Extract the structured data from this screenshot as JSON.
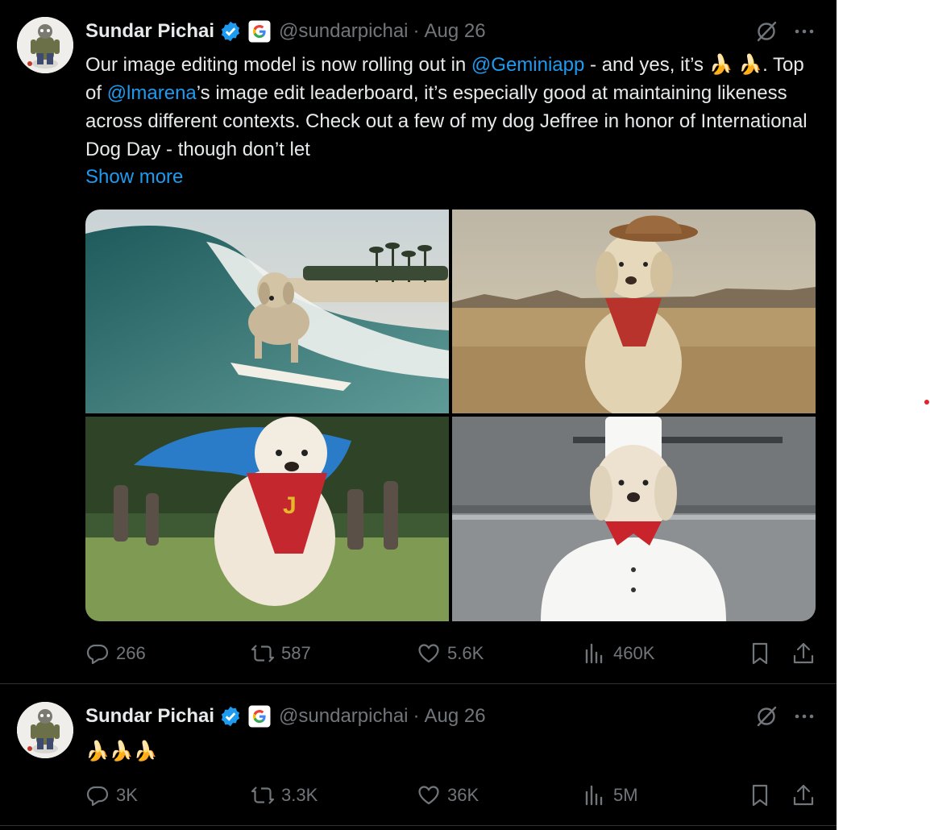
{
  "tweets": [
    {
      "author": "Sundar Pichai",
      "handle": "@sundarpichai",
      "sep": "·",
      "date": "Aug 26",
      "text": {
        "p1": "Our image editing model is now rolling out in ",
        "m1": "@Geminiapp",
        "p2": " - and yes, it’s 🍌 🍌. Top of ",
        "m2": "@lmarena",
        "p3": "’s image edit leaderboard, it’s especially good at maintaining likeness across different contexts. Check out a few of my dog Jeffree in honor of International Dog Day - though don’t let"
      },
      "show_more": "Show more",
      "media": [
        "dog surfing a wave",
        "dog in cowboy hat in desert",
        "dog in superhero cape",
        "dog dressed as chef"
      ],
      "metrics": {
        "replies": "266",
        "reposts": "587",
        "likes": "5.6K",
        "views": "460K"
      }
    },
    {
      "author": "Sundar Pichai",
      "handle": "@sundarpichai",
      "sep": "·",
      "date": "Aug 26",
      "text": "🍌🍌🍌",
      "metrics": {
        "replies": "3K",
        "reposts": "3.3K",
        "likes": "36K",
        "views": "5M"
      }
    }
  ],
  "icons": [
    "verified-badge-icon",
    "google-g-icon",
    "grok-icon",
    "more-icon",
    "reply-icon",
    "repost-icon",
    "like-icon",
    "views-icon",
    "bookmark-icon",
    "share-icon"
  ],
  "colors": {
    "background": "#000000",
    "text": "#e7e9ea",
    "muted": "#71767b",
    "link": "#1d9bf0",
    "divider": "#2f3336"
  }
}
